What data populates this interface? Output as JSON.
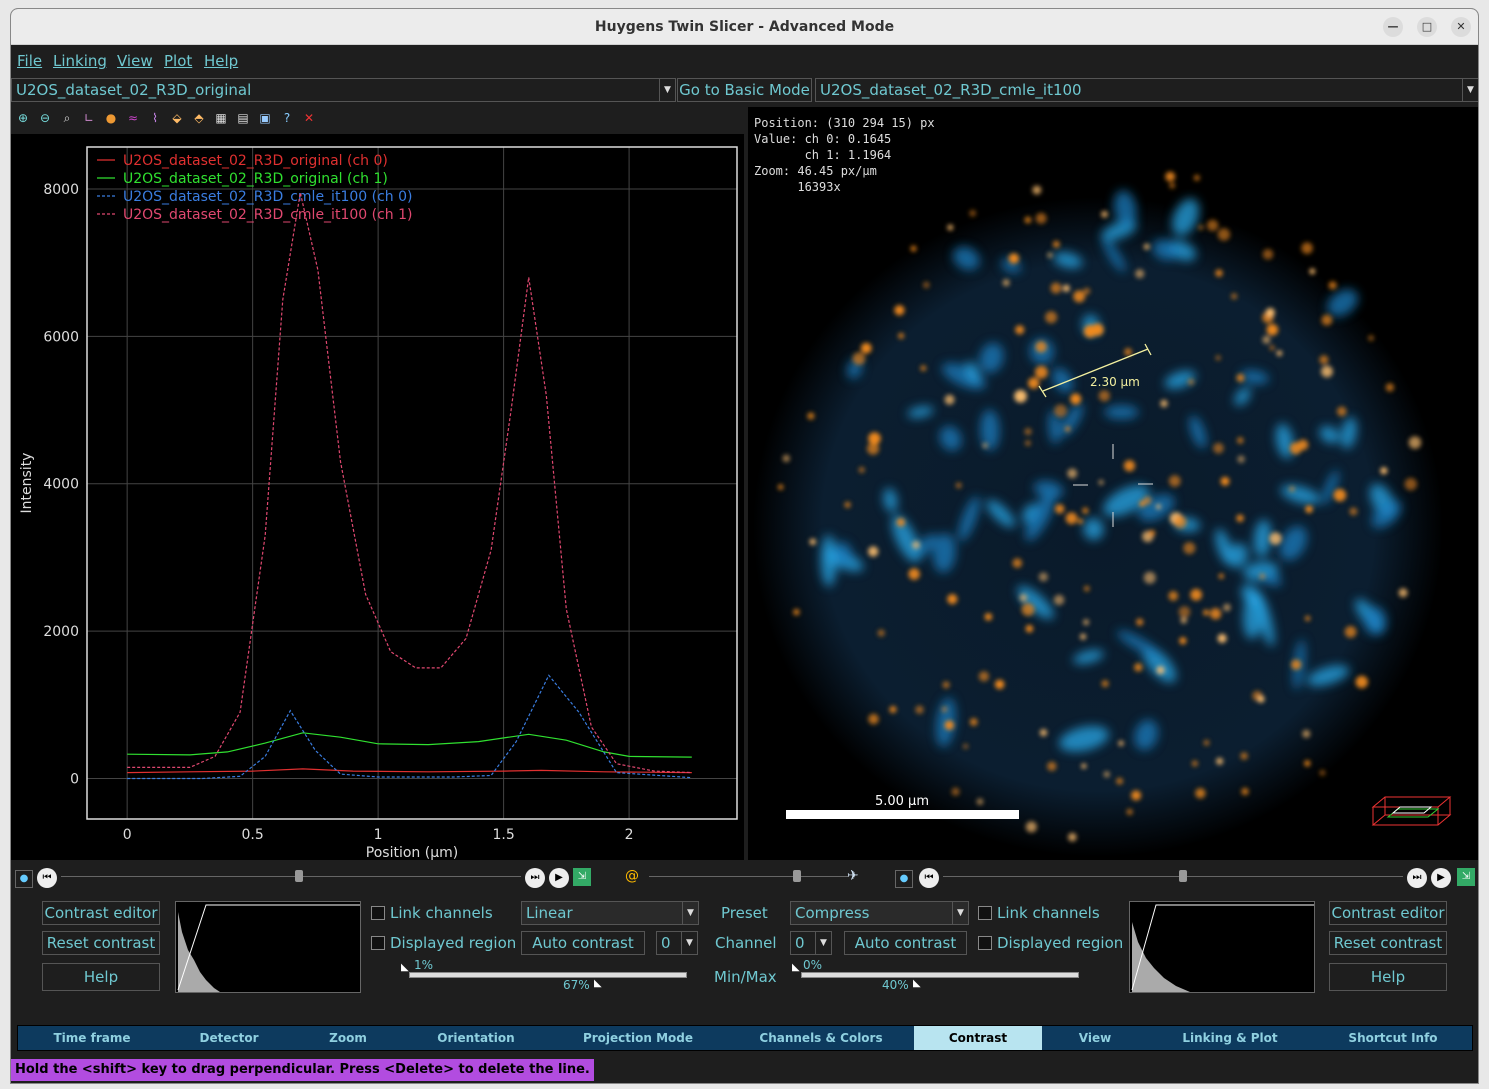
{
  "window": {
    "title": "Huygens Twin Slicer - Advanced Mode"
  },
  "menu": {
    "items": [
      "File",
      "Linking",
      "View",
      "Plot",
      "Help"
    ]
  },
  "left_dataset": "U2OS_dataset_02_R3D_original",
  "right_dataset": "U2OS_dataset_02_R3D_cmle_it100",
  "basic_mode_label": "Go to Basic Mode",
  "chart_data": {
    "type": "line",
    "xlabel": "Position (µm)",
    "ylabel": "Intensity",
    "xlim": [
      -0.16,
      2.43
    ],
    "ylim": [
      -550,
      8570
    ],
    "xticks": [
      "0",
      "0.5",
      "1",
      "1.5",
      "2"
    ],
    "yticks": [
      "0",
      "2000",
      "4000",
      "6000",
      "8000"
    ],
    "legend_position": "top-left",
    "series": [
      {
        "name": "U2OS_dataset_02_R3D_original (ch 0)",
        "color": "#e03030",
        "style": "solid",
        "x": [
          0,
          0.25,
          0.5,
          0.7,
          0.9,
          1.2,
          1.5,
          1.65,
          1.9,
          2.25
        ],
        "y": [
          80,
          90,
          100,
          130,
          100,
          90,
          100,
          110,
          90,
          80
        ]
      },
      {
        "name": "U2OS_dataset_02_R3D_original (ch 1)",
        "color": "#30e030",
        "style": "solid",
        "x": [
          0,
          0.25,
          0.4,
          0.55,
          0.7,
          0.85,
          1.0,
          1.2,
          1.4,
          1.6,
          1.75,
          1.9,
          2.0,
          2.25
        ],
        "y": [
          330,
          320,
          360,
          480,
          620,
          560,
          470,
          460,
          500,
          600,
          520,
          360,
          300,
          290
        ]
      },
      {
        "name": "U2OS_dataset_02_R3D_cmle_it100 (ch 0)",
        "color": "#3a7de0",
        "style": "dashed",
        "x": [
          0,
          0.3,
          0.45,
          0.55,
          0.65,
          0.75,
          0.85,
          1.0,
          1.3,
          1.45,
          1.55,
          1.68,
          1.8,
          1.95,
          2.25
        ],
        "y": [
          0,
          0,
          30,
          300,
          920,
          380,
          60,
          20,
          20,
          40,
          500,
          1400,
          900,
          80,
          10
        ]
      },
      {
        "name": "U2OS_dataset_02_R3D_cmle_it100 (ch 1)",
        "color": "#e04870",
        "style": "dashed",
        "x": [
          0,
          0.25,
          0.35,
          0.45,
          0.55,
          0.62,
          0.69,
          0.76,
          0.85,
          0.95,
          1.05,
          1.15,
          1.25,
          1.35,
          1.45,
          1.53,
          1.6,
          1.67,
          1.75,
          1.85,
          1.95,
          2.1,
          2.25
        ],
        "y": [
          150,
          150,
          300,
          900,
          3300,
          6500,
          7950,
          6900,
          4300,
          2500,
          1720,
          1500,
          1500,
          1900,
          3100,
          5000,
          6800,
          5200,
          2300,
          700,
          200,
          100,
          80
        ]
      }
    ]
  },
  "image_view": {
    "position": "Position: (310 294 15) px",
    "value_ch0": "Value: ch 0: 0.1645",
    "value_ch1": "ch 1: 1.1964",
    "zoom": "Zoom: 46.45 px/µm",
    "zoom_factor": "16393x",
    "line_length": "2.30 µm",
    "scalebar": "5.00 µm"
  },
  "contrast": {
    "contrast_editor": "Contrast editor",
    "reset_contrast": "Reset contrast",
    "help": "Help",
    "link_channels": "Link channels",
    "displayed_region": "Displayed region",
    "auto_contrast": "Auto contrast",
    "preset_label": "Preset",
    "channel_label": "Channel",
    "minmax_label": "Min/Max",
    "left_preset": "Linear",
    "right_preset": "Compress",
    "left_channel": "0",
    "right_channel": "0",
    "left_min": "1%",
    "left_max": "67%",
    "right_min": "0%",
    "right_max": "40%"
  },
  "tabs": [
    "Time frame",
    "Detector",
    "Zoom",
    "Orientation",
    "Projection Mode",
    "Channels & Colors",
    "Contrast",
    "View",
    "Linking & Plot",
    "Shortcut Info"
  ],
  "active_tab": "Contrast",
  "status": "Hold the <shift> key to drag perpendicular. Press <Delete> to delete the line."
}
